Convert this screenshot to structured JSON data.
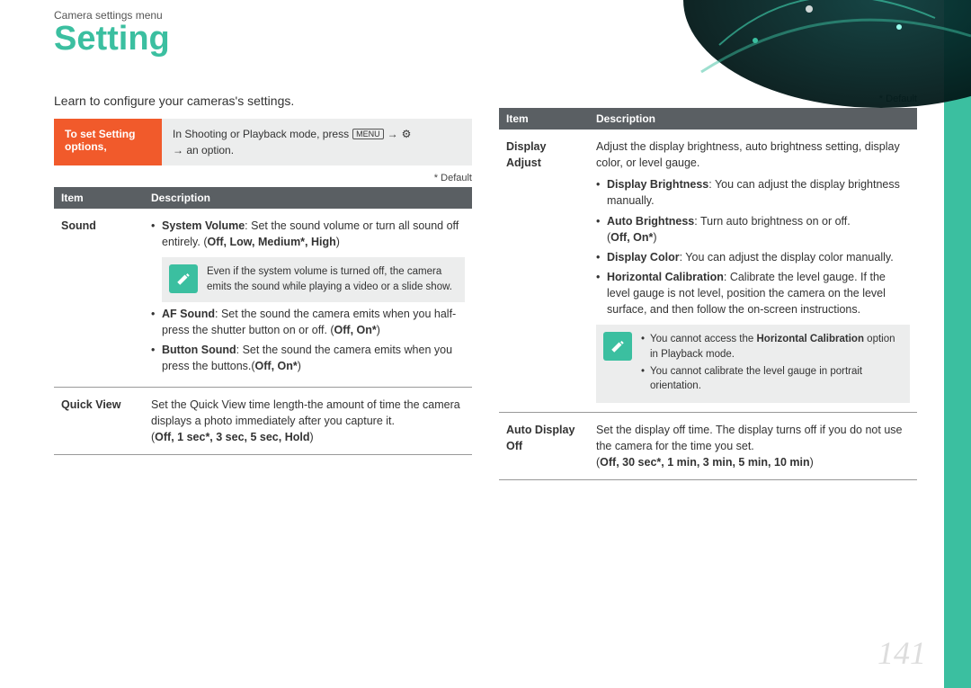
{
  "breadcrumb": "Camera settings menu",
  "title": "Setting",
  "intro": "Learn to configure your cameras's settings.",
  "page_number": "141",
  "default_label": "* Default",
  "instr": {
    "left": "To set Setting options,",
    "right_pre": "In Shooting or Playback mode, press ",
    "menu_key": "MENU",
    "arrow": " → ",
    "gear": "⚙",
    "right_post": " → an option."
  },
  "headers": {
    "item": "Item",
    "desc": "Description"
  },
  "left_table": {
    "sound": {
      "label": "Sound",
      "sysvol_b": "System Volume",
      "sysvol_t": ": Set the sound volume or turn all sound off entirely. (",
      "sysvol_opts": "Off, Low, Medium*, High",
      "close": ")",
      "note": "Even if the system volume is turned off, the camera emits the sound while playing a video or a slide show.",
      "af_b": "AF Sound",
      "af_t": ": Set the sound the camera emits when you half-press the shutter button on or off. (",
      "af_opts": "Off, On*",
      "btn_b": "Button Sound",
      "btn_t": ": Set the sound the camera emits when you press the buttons.(",
      "btn_opts": "Off, On*"
    },
    "quickview": {
      "label": "Quick View",
      "text": "Set the Quick View time length-the amount of time the camera displays a photo immediately after you capture it.",
      "opts": "Off, 1 sec*, 3 sec, 5 sec, Hold"
    }
  },
  "right_table": {
    "display": {
      "label": "Display Adjust",
      "intro": "Adjust the display brightness, auto brightness setting, display color, or level gauge.",
      "db_b": "Display Brightness",
      "db_t": ": You can adjust the display brightness manually.",
      "ab_b": "Auto Brightness",
      "ab_t": ": Turn auto brightness on or off.",
      "ab_opts": "Off, On*",
      "dc_b": "Display Color",
      "dc_t": ": You can adjust the display color manually.",
      "hc_b": "Horizontal Calibration",
      "hc_t": ": Calibrate the level gauge. If the level gauge is not level, position the camera on the level surface, and then follow the on-screen instructions.",
      "note1_pre": "You cannot access the ",
      "note1_b": "Horizontal Calibration",
      "note1_post": " option in Playback mode.",
      "note2": "You cannot calibrate the level gauge in portrait orientation."
    },
    "autodisp": {
      "label": "Auto Display Off",
      "text": "Set the display off time. The display turns off if you do not use the camera for the time you set.",
      "opts": "Off, 30 sec*, 1 min, 3 min, 5 min, 10 min"
    }
  }
}
